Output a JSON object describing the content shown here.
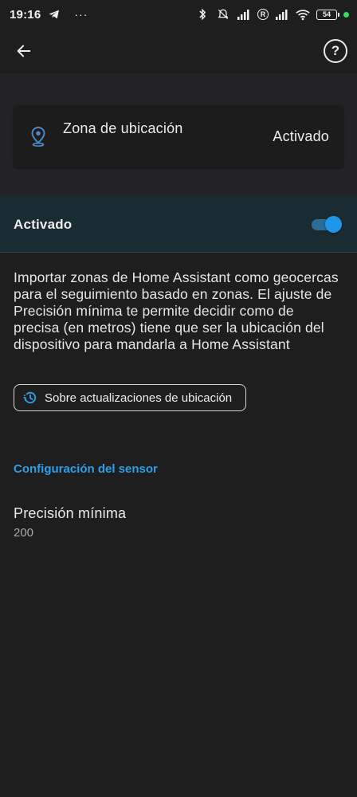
{
  "status_bar": {
    "time": "19:16",
    "dots": "···",
    "battery": "54",
    "sim_label": "R",
    "icons": [
      "telegram-icon",
      "bluetooth-icon",
      "mute-icon",
      "signal-icon",
      "wifi-icon",
      "battery-icon"
    ]
  },
  "app_bar": {
    "back_icon": "arrow-left-icon",
    "help_label": "?"
  },
  "zone_card": {
    "icon": "location-pin-icon",
    "title": "Zona de ubicación",
    "status": "Activado"
  },
  "enabled_row": {
    "label": "Activado",
    "toggle_on": true
  },
  "description": "Importar zonas de Home Assistant como geocercas para el seguimiento basado en zonas. El ajuste de Precisión mínima te permite decidir como de precisa (en metros) tiene que ser la ubicación del dispositivo para mandarla a Home Assistant",
  "info_button": {
    "icon": "history-icon",
    "label": "Sobre actualizaciones de ubicación"
  },
  "section": {
    "title": "Configuración del sensor"
  },
  "setting": {
    "title": "Precisión mínima",
    "value": "200"
  },
  "colors": {
    "background": "#1e1e1e",
    "header_band": "#232325",
    "enabled_row_bg": "#1b2b32",
    "accent": "#1f97e8",
    "section_header": "#2d9fe8"
  }
}
